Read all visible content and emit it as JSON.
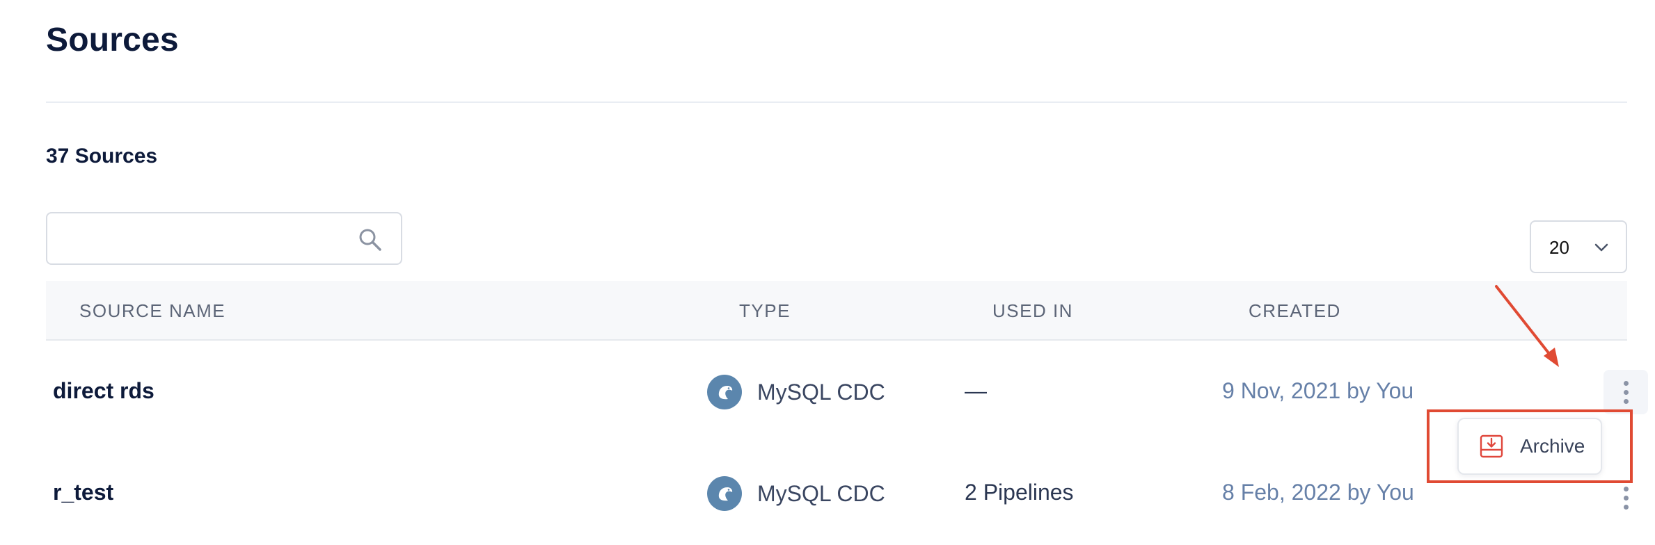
{
  "page": {
    "title": "Sources",
    "count_label": "37 Sources"
  },
  "search": {
    "value": "",
    "placeholder": ""
  },
  "pagination": {
    "page_size": "20"
  },
  "table": {
    "headers": {
      "name": "SOURCE NAME",
      "type": "TYPE",
      "used_in": "USED IN",
      "created": "CREATED"
    },
    "rows": [
      {
        "name": "direct rds",
        "type": "MySQL CDC",
        "used_in": "—",
        "created": "9 Nov, 2021 by You",
        "type_icon": "mysql-dolphin-icon"
      },
      {
        "name": "r_test",
        "type": "MySQL CDC",
        "used_in": "2 Pipelines",
        "created": "8 Feb, 2022 by You",
        "type_icon": "mysql-dolphin-icon"
      }
    ]
  },
  "row_menu": {
    "archive_label": "Archive"
  },
  "colors": {
    "annotation": "#e04a33",
    "type_icon_bg": "#5b86ad",
    "created_text": "#6680a8",
    "archive_icon": "#e0473c"
  }
}
